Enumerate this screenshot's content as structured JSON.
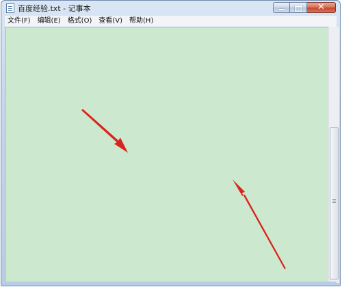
{
  "window": {
    "title": "百度经验.txt - 记事本",
    "icon": "notepad-icon"
  },
  "menu": {
    "items": [
      "文件(F)",
      "编辑(E)",
      "格式(O)",
      "查看(V)",
      "帮助(H)"
    ]
  },
  "editor": {
    "content": "",
    "background_color": "#cce8cf"
  },
  "caption_buttons": {
    "minimize_icon": "minimize-icon",
    "maximize_icon": "maximize-icon",
    "close_icon": "close-icon",
    "close_glyph": "✕"
  },
  "annotations": {
    "arrow_color": "#d9261c",
    "icons": [
      "red-arrow-icon",
      "red-arrow-icon"
    ]
  }
}
